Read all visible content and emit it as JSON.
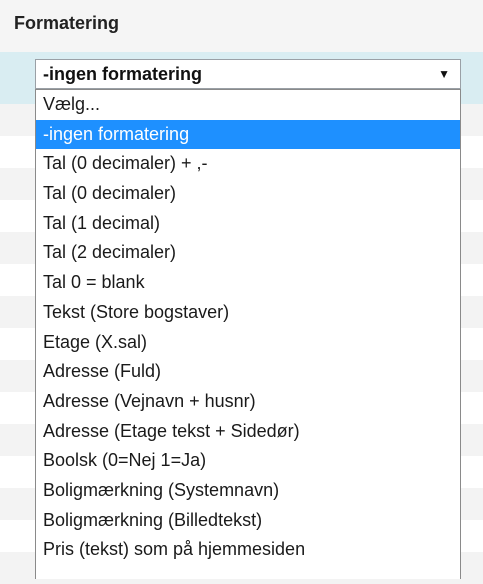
{
  "section": {
    "title": "Formatering"
  },
  "select": {
    "value": "-ingen formatering"
  },
  "options": [
    "Vælg...",
    "-ingen formatering",
    "Tal (0 decimaler) + ,-",
    "Tal (0 decimaler)",
    "Tal (1 decimal)",
    "Tal (2 decimaler)",
    "Tal 0 = blank",
    "Tekst (Store bogstaver)",
    "Etage (X.sal)",
    "Adresse (Fuld)",
    "Adresse (Vejnavn + husnr)",
    "Adresse (Etage tekst + Sidedør)",
    "Boolsk (0=Nej 1=Ja)",
    "Boligmærkning (Systemnavn)",
    "Boligmærkning (Billedtekst)",
    "Pris (tekst) som på hjemmesiden"
  ],
  "selected_option": "-ingen formatering",
  "colors": {
    "highlight": "#1e90ff",
    "header_band": "#d9edf2"
  },
  "icons": {
    "dropdown": "chevron-down-icon"
  }
}
